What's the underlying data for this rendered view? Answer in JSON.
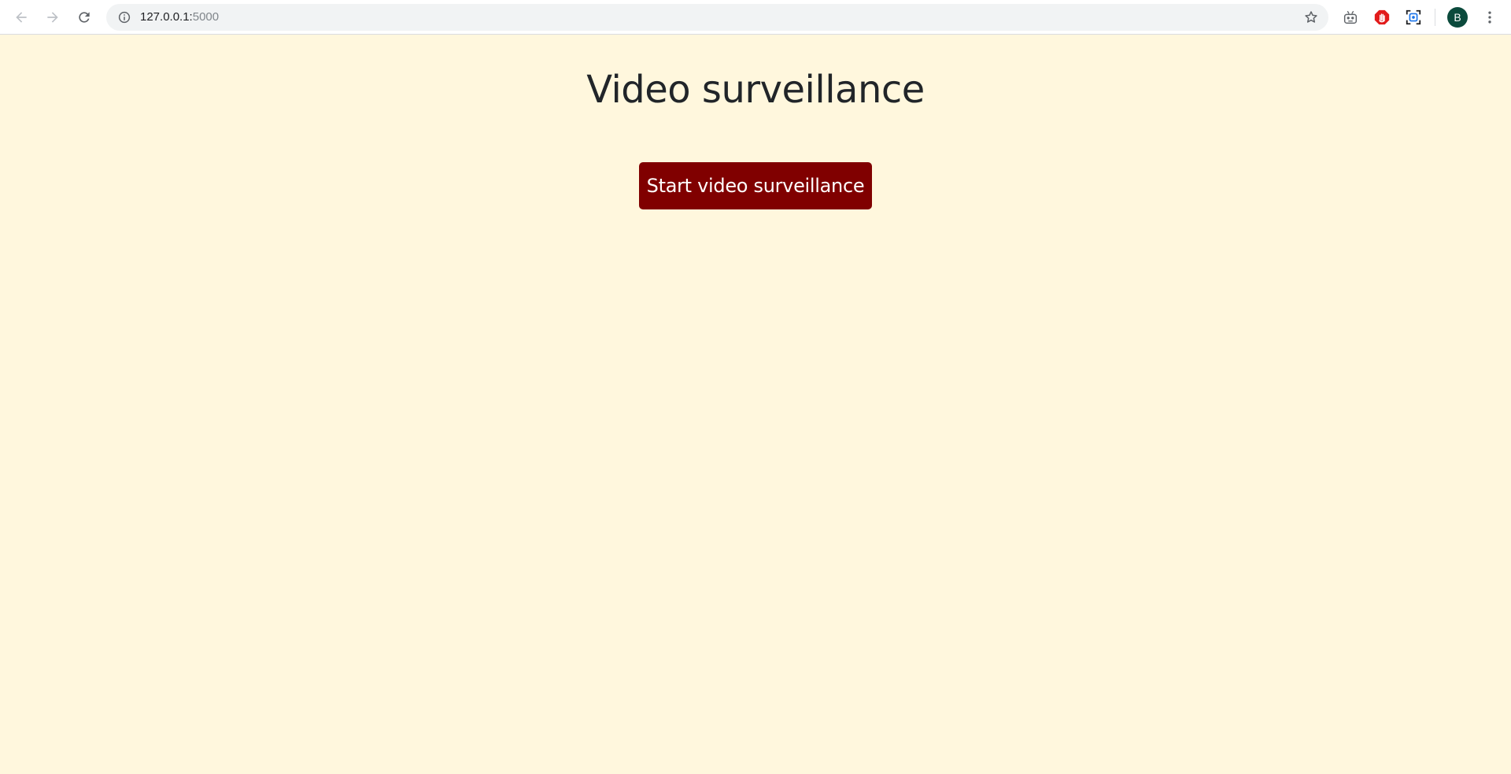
{
  "browser": {
    "url_host": "127.0.0.1:",
    "url_port": "5000",
    "icons": {
      "back": "back-arrow-icon",
      "forward": "forward-arrow-icon",
      "reload": "reload-icon",
      "site_info": "info-icon",
      "bookmark": "star-icon",
      "extensions": [
        "robot-extension-icon",
        "stop-hand-extension-icon",
        "screenshot-extension-icon"
      ],
      "menu": "kebab-menu-icon"
    },
    "avatar_letter": "B",
    "avatar_color": "#0b4a3c"
  },
  "page": {
    "title": "Video surveillance",
    "start_button_label": "Start video surveillance",
    "background_color": "#fff7dd",
    "button_color": "#800000"
  }
}
